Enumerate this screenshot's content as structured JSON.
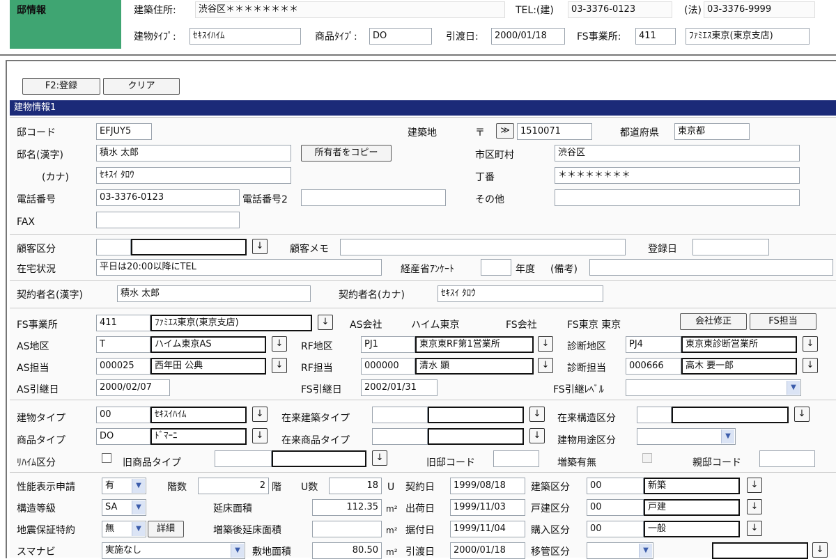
{
  "top": {
    "section_label": "邸情報",
    "address_label": "建築住所:",
    "address_value": "渋谷区＊＊＊＊＊＊＊＊",
    "tel_label": "TEL:(建)",
    "tel_value": "03-3376-0123",
    "tel2_label": "(法)",
    "tel2_value": "03-3376-9999",
    "building_type_label": "建物ﾀｲﾌﾟ:",
    "building_type_value": "ｾｷｽｲﾊｲﾑ",
    "product_type_label": "商品ﾀｲﾌﾟ:",
    "product_type_value": "DO",
    "delivery_label": "引渡日:",
    "delivery_value": "2000/01/18",
    "fs_office_label": "FS事業所:",
    "fs_office_code": "411",
    "fs_office_name": "ﾌｧﾐｴｽ東京(東京支店)"
  },
  "toolbar": {
    "register_label": "F2:登録",
    "clear_label": "クリア"
  },
  "section_header": "建物情報1",
  "building": {
    "code_label": "邸コード",
    "code_value": "EFJUY5",
    "site_label": "建築地",
    "postal_mark": "〒",
    "postal_btn": "≫",
    "postal_value": "1510071",
    "pref_label": "都道府県",
    "pref_value": "東京都",
    "name_label": "邸名(漢字)",
    "name_value": "積水 太郎",
    "copy_owner_label": "所有者をコピー",
    "city_label": "市区町村",
    "city_value": "渋谷区",
    "kana_label": "(カナ)",
    "kana_value": "ｾｷｽｲ ﾀﾛｳ",
    "chome_label": "丁番",
    "chome_value": "＊＊＊＊＊＊＊＊",
    "phone_label": "電話番号",
    "phone_value": "03-3376-0123",
    "phone2_label": "電話番号2",
    "other_label": "その他",
    "fax_label": "FAX"
  },
  "customer": {
    "category_label": "顧客区分",
    "memo_label": "顧客メモ",
    "reg_date_label": "登録日",
    "home_status_label": "在宅状況",
    "home_status_value": "平日は20:00以降にTEL",
    "meti_label": "経産省ｱﾝｹｰﾄ",
    "year_label": "年度",
    "note_label": "(備考)"
  },
  "contract": {
    "kanji_label": "契約者名(漢字)",
    "kanji_value": "積水 太郎",
    "kana_label": "契約者名(カナ)",
    "kana_value": "ｾｷｽｲ ﾀﾛｳ"
  },
  "fs": {
    "office_label": "FS事業所",
    "office_code": "411",
    "office_name": "ﾌｧﾐｴｽ東京(東京支店)",
    "as_company_label": "AS会社",
    "as_company_value": "ハイム東京",
    "fs_company_label": "FS会社",
    "fs_company_value": "FS東京 東京",
    "fix_company_label": "会社修正",
    "fs_staff_btn": "FS担当",
    "as_area_label": "AS地区",
    "as_area_code": "T",
    "as_area_name": "ハイム東京AS",
    "rf_area_label": "RF地区",
    "rf_area_code": "PJ1",
    "rf_area_name": "東京東RF第1営業所",
    "diag_area_label": "診断地区",
    "diag_area_code": "PJ4",
    "diag_area_name": "東京東診断営業所",
    "as_staff_label": "AS担当",
    "as_staff_code": "000025",
    "as_staff_name": "西年田 公典",
    "rf_staff_label": "RF担当",
    "rf_staff_code": "000000",
    "rf_staff_name": "清水 顕",
    "diag_staff_label": "診断担当",
    "diag_staff_code": "000666",
    "diag_staff_name": "高木 要一郎",
    "as_handover_label": "AS引継日",
    "as_handover_value": "2000/02/07",
    "fs_handover_label": "FS引継日",
    "fs_handover_value": "2002/01/31",
    "fs_level_label": "FS引継ﾚﾍﾞﾙ"
  },
  "types": {
    "building_type_label": "建物タイプ",
    "building_type_code": "00",
    "building_type_name": "ｾｷｽｲﾊｲﾑ",
    "legacy_building_label": "在来建築タイプ",
    "legacy_struct_label": "在来構造区分",
    "product_type_label": "商品タイプ",
    "product_type_code": "DO",
    "product_type_name": "ﾄﾞﾏｰﾆ",
    "legacy_product_label": "在来商品タイプ",
    "usage_label": "建物用途区分",
    "reheim_label": "ﾘﾊｲﾑ区分",
    "old_product_label": "旧商品タイプ",
    "old_code_label": "旧邸コード",
    "extension_label": "増築有無",
    "parent_code_label": "親邸コード"
  },
  "perf": {
    "perf_label": "性能表示申請",
    "perf_value": "有",
    "floors_label": "階数",
    "floors_value": "2",
    "floors_unit": "階",
    "units_label": "U数",
    "units_value": "18",
    "units_unit": "U",
    "contract_date_label": "契約日",
    "contract_date_value": "1999/08/18",
    "build_cat_label": "建築区分",
    "build_cat_code": "00",
    "build_cat_name": "新築",
    "struct_grade_label": "構造等級",
    "struct_grade_value": "SA",
    "floor_area_label": "延床面積",
    "floor_area_value": "112.35",
    "area_unit": "m²",
    "ship_date_label": "出荷日",
    "ship_date_value": "1999/11/03",
    "house_cat_label": "戸建区分",
    "house_cat_code": "00",
    "house_cat_name": "戸建",
    "quake_label": "地震保証特約",
    "quake_value": "無",
    "detail_label": "詳細",
    "after_ext_label": "増築後延床面積",
    "install_date_label": "据付日",
    "install_date_value": "1999/11/04",
    "purchase_cat_label": "購入区分",
    "purchase_cat_code": "00",
    "purchase_cat_name": "一般",
    "sumanavi_label": "スマナビ",
    "sumanavi_value": "実施なし",
    "site_area_label": "敷地面積",
    "site_area_value": "80.50",
    "handover_date_label": "引渡日",
    "handover_date_value": "2000/01/18",
    "transfer_label": "移管区分"
  },
  "icons": {
    "arrow": "↓",
    "dropdown": "▼"
  }
}
